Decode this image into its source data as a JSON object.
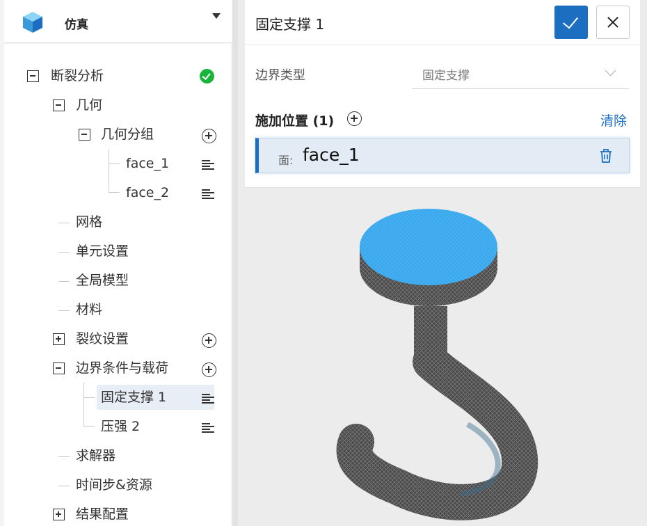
{
  "sidebar": {
    "title": "仿真",
    "logo_icon": "cube-icon",
    "header_chevron_icon": "caret-down-icon",
    "tree": {
      "root_label": "断裂分析",
      "root_status": "complete",
      "geometry_label": "几何",
      "geometry_group_label": "几何分组",
      "face_1_label": "face_1",
      "face_2_label": "face_2",
      "mesh_label": "网格",
      "element_settings_label": "单元设置",
      "global_model_label": "全局模型",
      "material_label": "材料",
      "crack_settings_label": "裂纹设置",
      "bc_loads_label": "边界条件与载荷",
      "fixed_support_label": "固定支撑 1",
      "pressure_label": "压强 2",
      "solver_label": "求解器",
      "timestep_label": "时间步&资源",
      "result_config_label": "结果配置"
    }
  },
  "props": {
    "title": "固定支撑 1",
    "confirm_icon": "check-icon",
    "close_icon": "close-icon",
    "boundary_type_label": "边界类型",
    "boundary_type_value": "固定支撑",
    "apply_location_label": "施加位置 (1)",
    "clear_label": "清除",
    "location_prefix": "面:",
    "location_value": "face_1",
    "trash_icon": "trash-icon"
  },
  "colors": {
    "accent": "#1c6fc0",
    "status_ok": "#19b53a",
    "selected_face": "#3aa9ee",
    "mesh": "#505050"
  }
}
